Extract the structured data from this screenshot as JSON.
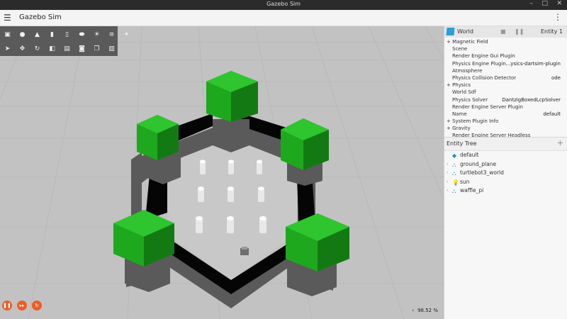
{
  "window": {
    "title": "Gazebo Sim",
    "minimize": "–",
    "maximize": "□",
    "close": "✕"
  },
  "appbar": {
    "title": "Gazebo Sim",
    "menu_icon": "☰",
    "more_icon": "⋮"
  },
  "toolbar": {
    "row1": [
      {
        "name": "box-shape-button",
        "glyph": "▣"
      },
      {
        "name": "sphere-shape-button",
        "glyph": "●"
      },
      {
        "name": "cone-shape-button",
        "glyph": "▲"
      },
      {
        "name": "cylinder-shape-button",
        "glyph": "▮"
      },
      {
        "name": "capsule-shape-button",
        "glyph": "▯"
      },
      {
        "name": "ellipsoid-shape-button",
        "glyph": "⬬"
      },
      {
        "name": "point-light-button",
        "glyph": "☀"
      },
      {
        "name": "directional-light-button",
        "glyph": "≡"
      },
      {
        "name": "spot-light-button",
        "glyph": "✦"
      }
    ],
    "row2": [
      {
        "name": "select-mode-button",
        "glyph": "➤"
      },
      {
        "name": "translate-mode-button",
        "glyph": "✥"
      },
      {
        "name": "rotate-mode-button",
        "glyph": "↻"
      },
      {
        "name": "snap-button",
        "glyph": "◧"
      },
      {
        "name": "grid-config-button",
        "glyph": "▤"
      },
      {
        "name": "screenshot-button",
        "glyph": "◙"
      },
      {
        "name": "copy-button",
        "glyph": "❐"
      },
      {
        "name": "paste-button",
        "glyph": "▥"
      }
    ]
  },
  "playback": {
    "pause": "❚❚",
    "step": "▸▸",
    "reset": "↻"
  },
  "stats": {
    "rtf": "98.52 %",
    "arrow": "‹"
  },
  "component_inspector": {
    "name": "World",
    "entity": "Entity 1",
    "lock_icon": "■",
    "pause_icon": "❚❚",
    "rows": [
      {
        "label": "+ Magnetic Field",
        "value": "",
        "group": true
      },
      {
        "label": "Scene",
        "value": "",
        "group": false
      },
      {
        "label": "Render Engine Gui Plugin",
        "value": "",
        "group": false
      },
      {
        "label": "Physics Engine Plugin",
        "value": "...ysics-dartsim-plugin",
        "group": false
      },
      {
        "label": "Atmosphere",
        "value": "",
        "group": false
      },
      {
        "label": "Physics Collision Detector",
        "value": "ode",
        "group": false
      },
      {
        "label": "+ Physics",
        "value": "",
        "group": true
      },
      {
        "label": "World Sdf",
        "value": "",
        "group": false
      },
      {
        "label": "Physics Solver",
        "value": "DantzigBoxedLcpSolver",
        "group": false
      },
      {
        "label": "Render Engine Server Plugin",
        "value": "",
        "group": false
      },
      {
        "label": "Name",
        "value": "default",
        "group": false
      },
      {
        "label": "+ System Plugin Info",
        "value": "",
        "group": true
      },
      {
        "label": "+ Gravity",
        "value": "",
        "group": true
      },
      {
        "label": "Render Engine Server Headless",
        "value": "",
        "group": false
      }
    ]
  },
  "entity_tree": {
    "title": "Entity Tree",
    "add_icon": "+",
    "items": [
      {
        "label": "default",
        "icon": "world-icon",
        "glyph": "◆",
        "arrow": ""
      },
      {
        "label": "ground_plane",
        "icon": "model-icon",
        "glyph": "⛬",
        "arrow": "›"
      },
      {
        "label": "turtlebot3_world",
        "icon": "model-icon",
        "glyph": "⛬",
        "arrow": "›"
      },
      {
        "label": "sun",
        "icon": "light-icon",
        "glyph": "💡",
        "arrow": "›"
      },
      {
        "label": "waffle_pi",
        "icon": "model-icon",
        "glyph": "⛬",
        "arrow": "›"
      }
    ]
  },
  "colors": {
    "accent": "#ef5b25",
    "tree_green": "#1e9e1e",
    "wall": "#000000",
    "ground": "#c2c2c2"
  }
}
